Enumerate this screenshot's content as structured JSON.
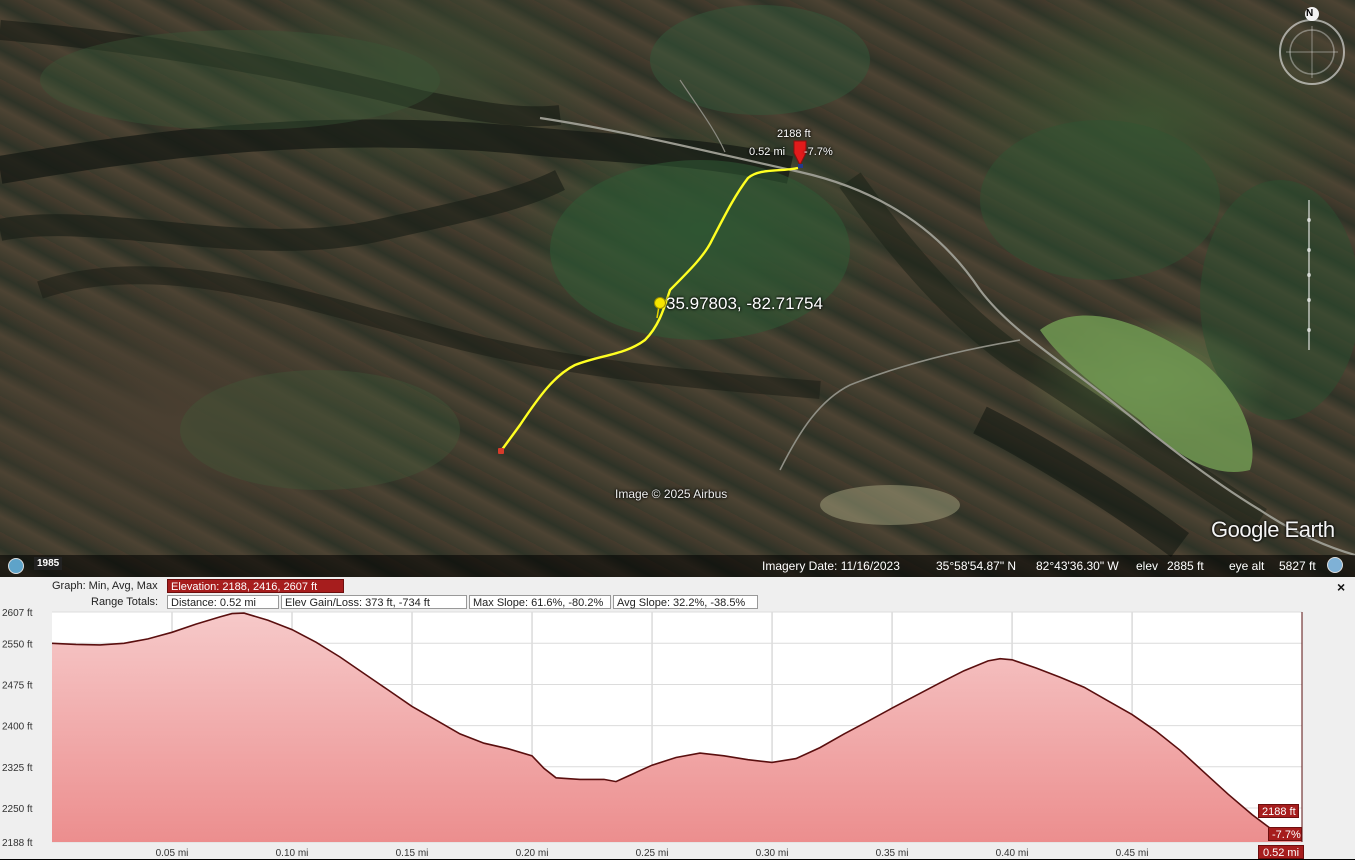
{
  "map": {
    "coordinate_label": "35.97803, -82.71754",
    "path_distance_label": "0.52 mi",
    "pin_elevation_label": "2188 ft",
    "pin_slope_label": "-7.7%",
    "credit": "Image © 2025 Airbus",
    "logo": "Google Earth",
    "compass_letter": "N",
    "year_badge": "1985",
    "icons": [
      "clock-icon",
      "compass-icon",
      "map-pin-icon",
      "pushpin-icon",
      "zoom-slider-icon",
      "close-icon"
    ],
    "colors": {
      "path": "#ffff22",
      "pin": "#e21b1b",
      "start_marker": "#d63b2a"
    }
  },
  "status": {
    "imagery_date": "Imagery Date: 11/16/2023",
    "latitude": "35°58'54.87\" N",
    "longitude": "82°43'36.30\" W",
    "elev_label": "elev",
    "elev_value": "2885 ft",
    "eye_alt_label": "eye alt",
    "eye_alt_value": "5827 ft"
  },
  "profile": {
    "graph_label": "Graph: Min, Avg, Max",
    "elevation_box": "Elevation: 2188, 2416, 2607 ft",
    "range_label": "Range Totals:",
    "distance_box": "Distance: 0.52 mi",
    "gain_box": "Elev Gain/Loss: 373 ft, -734 ft",
    "max_slope_box": "Max Slope: 61.6%, -80.2%",
    "avg_slope_box": "Avg Slope: 32.2%, -38.5%",
    "cursor_elev": "2188 ft",
    "cursor_slope": "-7.7%",
    "cursor_dist": "0.52 mi",
    "close_label": "×"
  },
  "chart_data": {
    "type": "area",
    "xlabel": "",
    "ylabel": "",
    "xlim": [
      0,
      0.5208
    ],
    "ylim": [
      2188,
      2607
    ],
    "x_ticks": [
      0.05,
      0.1,
      0.15,
      0.2,
      0.25,
      0.3,
      0.35,
      0.4,
      0.45
    ],
    "x_tick_labels": [
      "0.05 mi",
      "0.10 mi",
      "0.15 mi",
      "0.20 mi",
      "0.25 mi",
      "0.30 mi",
      "0.35 mi",
      "0.40 mi",
      "0.45 mi"
    ],
    "y_ticks": [
      2607,
      2550,
      2475,
      2400,
      2325,
      2250,
      2188
    ],
    "y_tick_labels": [
      "2607 ft",
      "2550 ft",
      "2475 ft",
      "2400 ft",
      "2325 ft",
      "2250 ft",
      "2188 ft"
    ],
    "grid": true,
    "series": [
      {
        "x": [
          0,
          0.01,
          0.02,
          0.03,
          0.04,
          0.05,
          0.06,
          0.07,
          0.075,
          0.08,
          0.09,
          0.1,
          0.11,
          0.12,
          0.13,
          0.14,
          0.15,
          0.16,
          0.17,
          0.18,
          0.19,
          0.2,
          0.205,
          0.21,
          0.22,
          0.23,
          0.235,
          0.24,
          0.25,
          0.26,
          0.27,
          0.28,
          0.29,
          0.3,
          0.31,
          0.32,
          0.33,
          0.34,
          0.35,
          0.36,
          0.37,
          0.38,
          0.39,
          0.395,
          0.4,
          0.41,
          0.42,
          0.43,
          0.44,
          0.45,
          0.46,
          0.47,
          0.48,
          0.49,
          0.5,
          0.51,
          0.5208
        ],
        "y": [
          2550,
          2548,
          2547,
          2550,
          2558,
          2570,
          2585,
          2598,
          2604,
          2605,
          2592,
          2575,
          2552,
          2525,
          2495,
          2465,
          2435,
          2410,
          2385,
          2368,
          2358,
          2345,
          2322,
          2305,
          2302,
          2302,
          2298,
          2308,
          2328,
          2342,
          2350,
          2345,
          2338,
          2333,
          2340,
          2360,
          2385,
          2408,
          2432,
          2455,
          2478,
          2500,
          2518,
          2522,
          2520,
          2505,
          2488,
          2470,
          2445,
          2420,
          2390,
          2355,
          2315,
          2275,
          2238,
          2205,
          2193
        ]
      }
    ]
  }
}
